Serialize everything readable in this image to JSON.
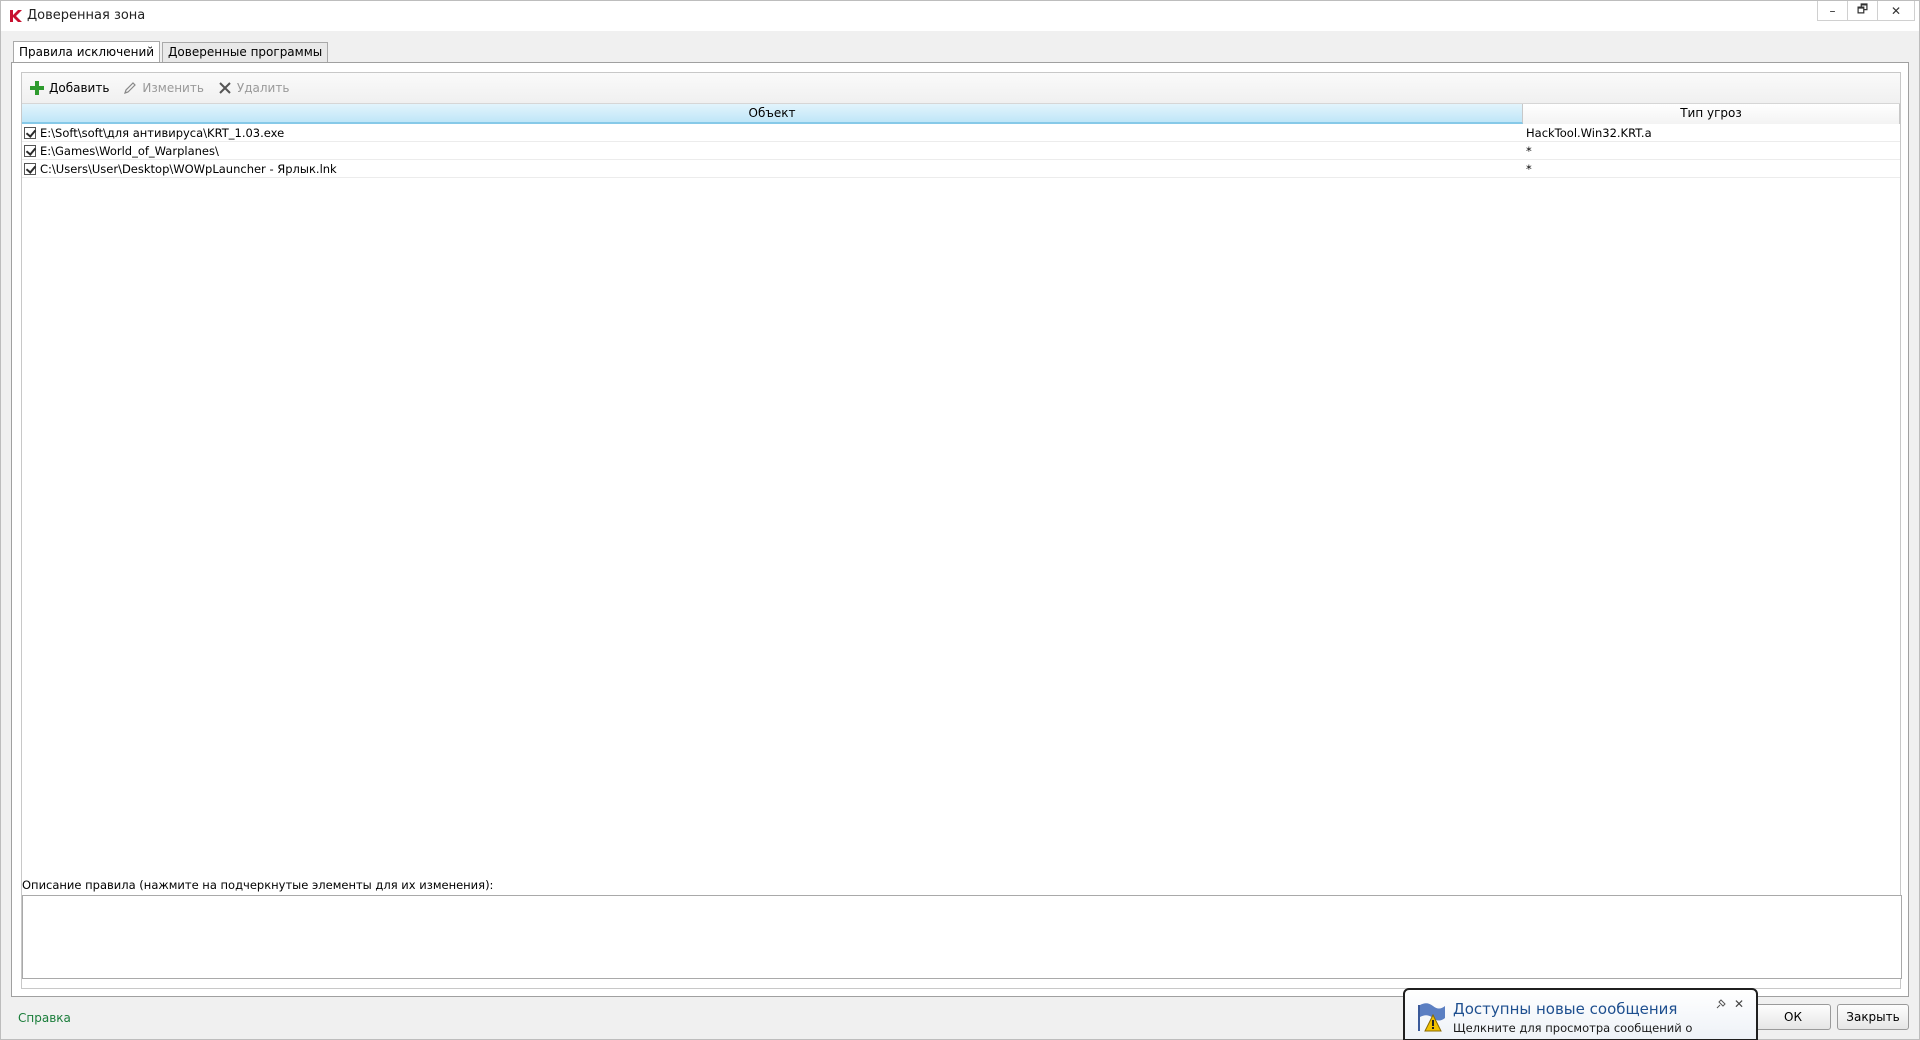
{
  "window": {
    "title": "Доверенная зона",
    "minimize": "–",
    "restore": "🗗",
    "close": "✕"
  },
  "tabs": [
    {
      "label": "Правила исключений",
      "active": true
    },
    {
      "label": "Доверенные программы",
      "active": false
    }
  ],
  "toolbar": {
    "add_label": "Добавить",
    "edit_label": "Изменить",
    "delete_label": "Удалить"
  },
  "table": {
    "columns": [
      "Объект",
      "Тип угроз"
    ],
    "rows": [
      {
        "checked": true,
        "object": "E:\\Soft\\soft\\для антивируса\\KRT_1.03.exe",
        "threat_type": "HackTool.Win32.KRT.a"
      },
      {
        "checked": true,
        "object": "E:\\Games\\World_of_Warplanes\\",
        "threat_type": "*"
      },
      {
        "checked": true,
        "object": "C:\\Users\\User\\Desktop\\WOWpLauncher - Ярлык.lnk",
        "threat_type": "*"
      }
    ]
  },
  "description": {
    "label": "Описание правила (нажмите на подчеркнутые элементы для их изменения):"
  },
  "footer": {
    "help_label": "Справка",
    "ok_label": "ОК",
    "close_label": "Закрыть"
  },
  "notification": {
    "title": "Доступны новые сообщения",
    "text": "Щелкните для просмотра сообщений о компьютере.",
    "close": "✕"
  },
  "colors": {
    "accent_header": "#bfe6f8",
    "help_link": "#1a7d3a",
    "notify_title": "#1e4f8f",
    "add_icon": "#2e9b2e"
  },
  "icons": [
    "kaspersky-logo-icon",
    "plus-icon",
    "pencil-icon",
    "cross-icon",
    "flag-warning-icon",
    "pin-icon"
  ]
}
